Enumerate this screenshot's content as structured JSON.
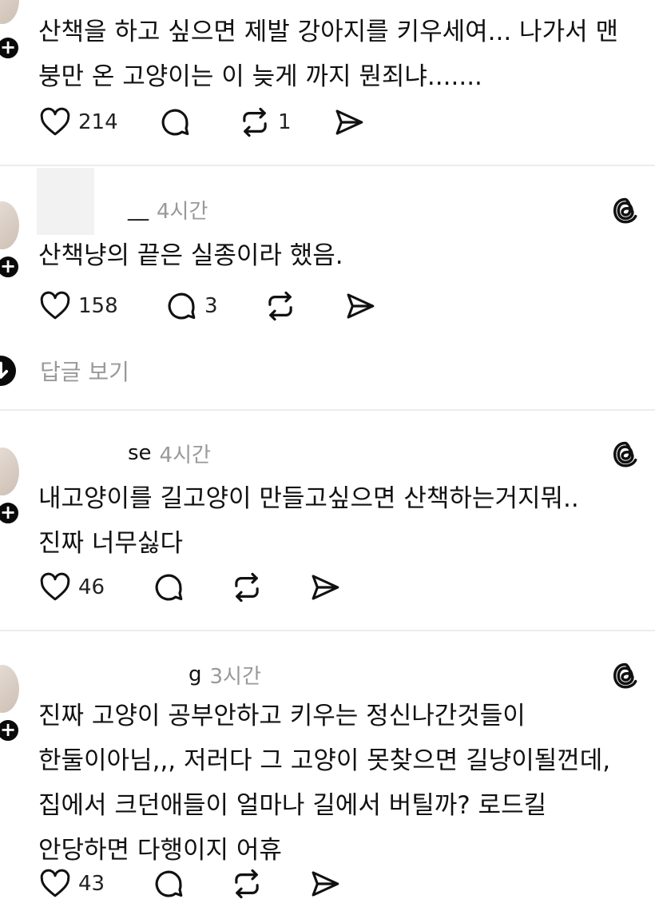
{
  "posts": [
    {
      "text": "산책을 하고 싶으면 제발 강아지를 키우세여... 나가서 맨 붕만 온 고양이는 이 늦게 까지 뭔죄냐.......",
      "likes": "214",
      "replies": "",
      "reposts": "1"
    },
    {
      "username": "__",
      "time": "4시간",
      "text": "산책냥의 끝은 실종이라 했음.",
      "likes": "158",
      "replies": "3",
      "reposts": ""
    },
    {
      "username": "se",
      "time": "4시간",
      "text": "내고양이를 길고양이 만들고싶으면 산책하는거지뭐.. 진짜 너무싫다",
      "likes": "46",
      "replies": "",
      "reposts": ""
    },
    {
      "username": "g",
      "time": "3시간",
      "text": "진짜 고양이 공부안하고 키우는 정신나간것들이 한둘이아님,,, 저러다 그 고양이 못찾으면 길냥이될껀데, 집에서 크던애들이 얼마나 길에서 버틸까? 로드킬 안당하면 다행이지 어휴",
      "likes": "43",
      "replies": "",
      "reposts": ""
    }
  ],
  "view_replies_label": "답글 보기",
  "colors": {
    "text": "#111111",
    "secondary": "#999999",
    "divider": "#ececec",
    "badge": "#0a0a0a"
  },
  "icons": [
    "heart-icon",
    "comment-icon",
    "repost-icon",
    "share-icon",
    "threads-icon",
    "plus-icon",
    "arrow-down-icon"
  ]
}
